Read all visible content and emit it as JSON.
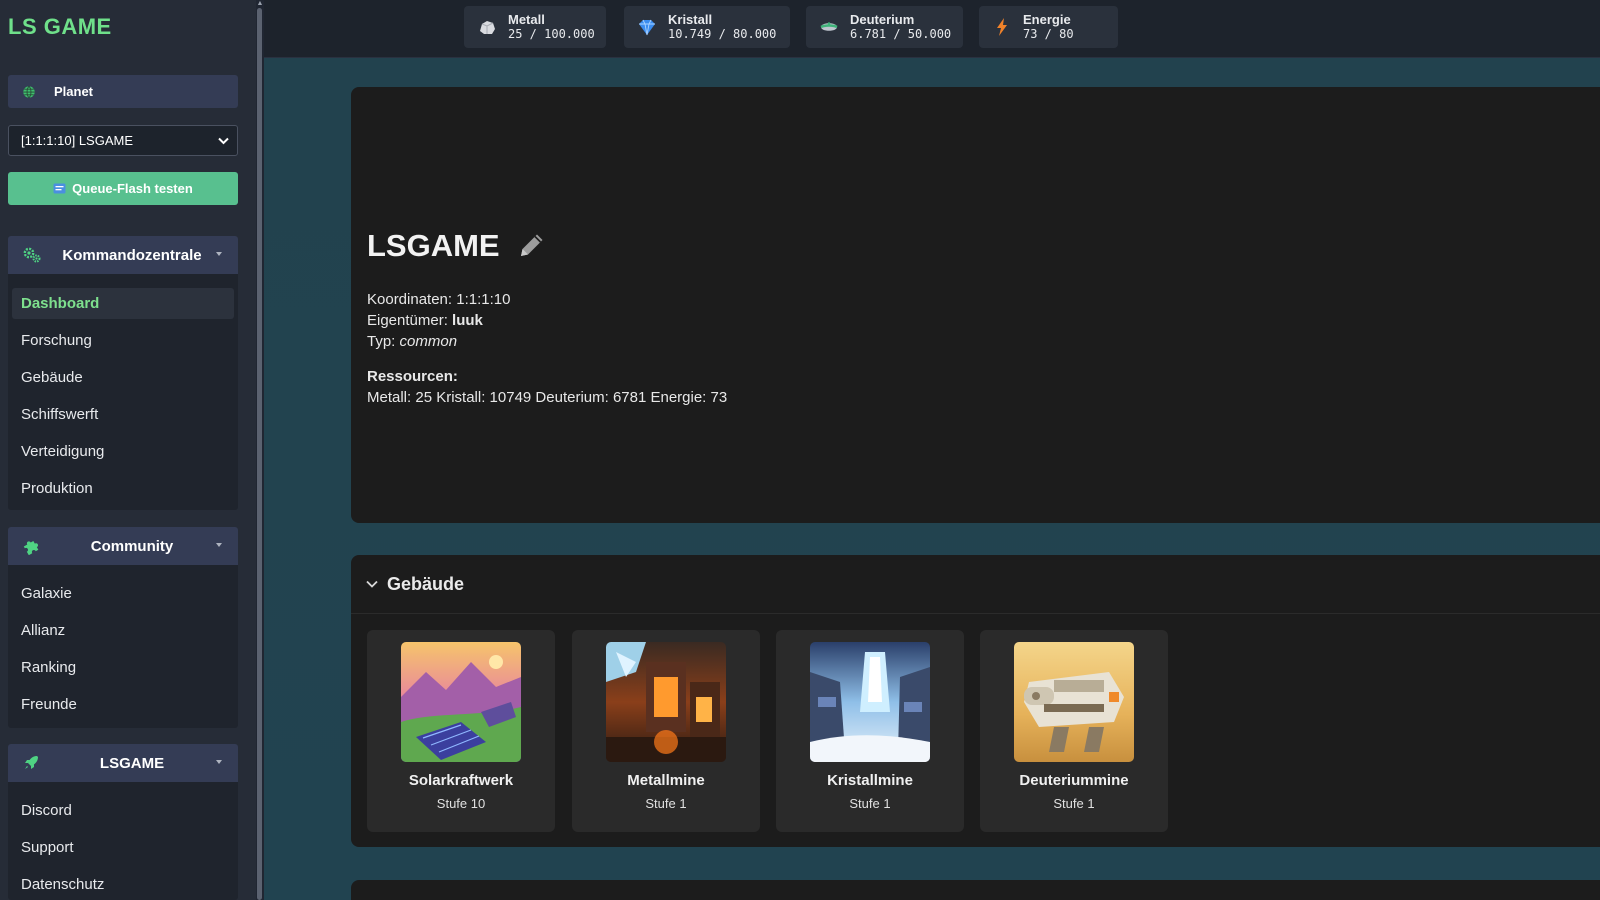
{
  "brand": "LS GAME",
  "sidebar": {
    "planet_header": "Planet",
    "planet_select": "[1:1:1:10] LSGAME",
    "queue_button": "Queue-Flash testen",
    "sections": [
      {
        "title": "Kommandozentrale",
        "icon": "cogs-icon",
        "items": [
          "Dashboard",
          "Forschung",
          "Gebäude",
          "Schiffswerft",
          "Verteidigung",
          "Produktion"
        ],
        "active": "Dashboard"
      },
      {
        "title": "Community",
        "icon": "puzzle-icon",
        "items": [
          "Galaxie",
          "Allianz",
          "Ranking",
          "Freunde"
        ]
      },
      {
        "title": "LSGAME",
        "icon": "rocket-icon",
        "items": [
          "Discord",
          "Support",
          "Datenschutz"
        ]
      }
    ]
  },
  "resources": [
    {
      "name": "Metall",
      "value": "25 / 100.000",
      "icon": "rock-icon"
    },
    {
      "name": "Kristall",
      "value": "10.749 / 80.000",
      "icon": "diamond-icon"
    },
    {
      "name": "Deuterium",
      "value": "6.781 / 50.000",
      "icon": "deuterium-icon"
    },
    {
      "name": "Energie",
      "value": "73 / 80",
      "icon": "lightning-icon"
    }
  ],
  "planet": {
    "name": "LSGAME",
    "koordinaten_label": "Koordinaten:",
    "koordinaten": "1:1:1:10",
    "eigentuemer_label": "Eigentümer:",
    "eigentuemer": "luuk",
    "typ_label": "Typ:",
    "typ": "common",
    "ressourcen_label": "Ressourcen:",
    "ressourcen_line": "Metall: 25 Kristall: 10749 Deuterium: 6781 Energie: 73"
  },
  "buildings": {
    "title": "Gebäude",
    "items": [
      {
        "name": "Solarkraftwerk",
        "level": "Stufe 10"
      },
      {
        "name": "Metallmine",
        "level": "Stufe 1"
      },
      {
        "name": "Kristallmine",
        "level": "Stufe 1"
      },
      {
        "name": "Deuteriummine",
        "level": "Stufe 1"
      }
    ]
  },
  "colors": {
    "brand_green": "#6fe08a",
    "queue_button": "#58c08f",
    "section_header": "#343c55"
  }
}
